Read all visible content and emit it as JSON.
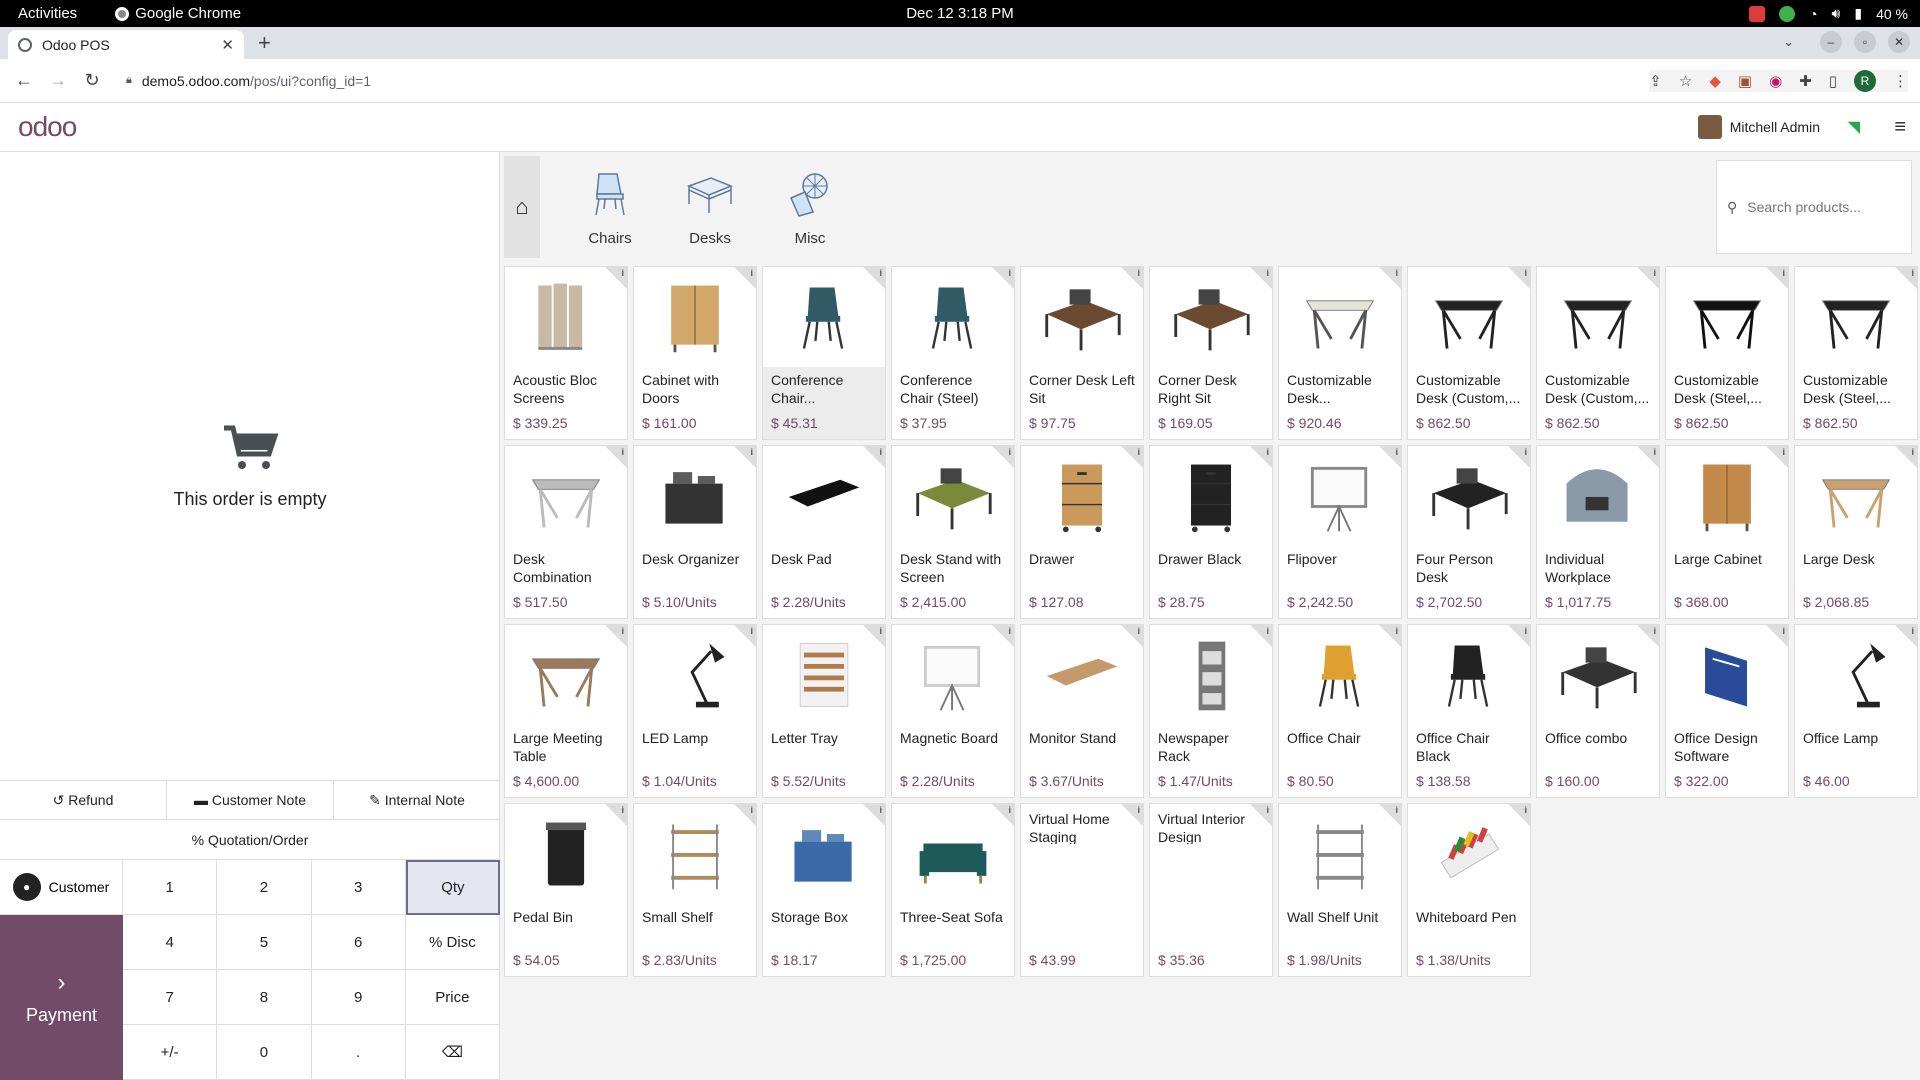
{
  "os": {
    "activities": "Activities",
    "app": "Google Chrome",
    "clock": "Dec 12  3:18 PM",
    "battery": "40 %"
  },
  "browser": {
    "tab_title": "Odoo POS",
    "url_host": "demo5.odoo.com",
    "url_path": "/pos/ui?config_id=1",
    "avatar": "R"
  },
  "header": {
    "logo": "odoo",
    "user": "Mitchell Admin"
  },
  "order": {
    "empty_text": "This order is empty"
  },
  "controls": {
    "refund": "Refund",
    "customer_note": "Customer Note",
    "internal_note": "Internal Note",
    "quotation": "Quotation/Order"
  },
  "pad": {
    "customer": "Customer",
    "payment": "Payment",
    "keys": [
      "1",
      "2",
      "3",
      "Qty",
      "4",
      "5",
      "6",
      "% Disc",
      "7",
      "8",
      "9",
      "Price",
      "+/-",
      "0",
      ".",
      "⌫"
    ]
  },
  "categories": [
    {
      "label": "Chairs"
    },
    {
      "label": "Desks"
    },
    {
      "label": "Misc"
    }
  ],
  "search": {
    "placeholder": "Search products..."
  },
  "products": [
    {
      "name": "Acoustic Bloc Screens",
      "price": "$ 339.25",
      "icon": "screen-icon",
      "color": "#c9b8a3"
    },
    {
      "name": "Cabinet with Doors",
      "price": "$ 161.00",
      "icon": "cabinet-icon",
      "color": "#d2a86a"
    },
    {
      "name": "Conference Chair...",
      "price": "$ 45.31",
      "icon": "chair-icon",
      "color": "#2f5a66"
    },
    {
      "name": "Conference Chair (Steel)",
      "price": "$ 37.95",
      "icon": "chair-icon",
      "color": "#2f5a66"
    },
    {
      "name": "Corner Desk Left Sit",
      "price": "$ 97.75",
      "icon": "desk-icon",
      "color": "#6b4a32"
    },
    {
      "name": "Corner Desk Right Sit",
      "price": "$ 169.05",
      "icon": "desk-icon",
      "color": "#6b4a32"
    },
    {
      "name": "Customizable Desk...",
      "price": "$ 920.46",
      "icon": "table-icon",
      "color": "#555555"
    },
    {
      "name": "Customizable Desk (Custom,...",
      "price": "$ 862.50",
      "icon": "table-icon",
      "color": "#222222"
    },
    {
      "name": "Customizable Desk (Custom,...",
      "price": "$ 862.50",
      "icon": "table-icon",
      "color": "#222222"
    },
    {
      "name": "Customizable Desk (Steel,...",
      "price": "$ 862.50",
      "icon": "table-icon",
      "color": "#111111"
    },
    {
      "name": "Customizable Desk (Steel,...",
      "price": "$ 862.50",
      "icon": "table-icon",
      "color": "#222222"
    },
    {
      "name": "Desk Combination",
      "price": "$ 517.50",
      "icon": "table-icon",
      "color": "#bbbbbb"
    },
    {
      "name": "Desk Organizer",
      "price": "$ 5.10/Units",
      "icon": "box-icon",
      "color": "#333333"
    },
    {
      "name": "Desk Pad",
      "price": "$ 2.28/Units",
      "icon": "pad-icon",
      "color": "#111111"
    },
    {
      "name": "Desk Stand with Screen",
      "price": "$ 2,415.00",
      "icon": "desk-icon",
      "color": "#7a8a3a"
    },
    {
      "name": "Drawer",
      "price": "$ 127.08",
      "icon": "drawer-icon",
      "color": "#c99a5c"
    },
    {
      "name": "Drawer Black",
      "price": "$ 28.75",
      "icon": "drawer-icon",
      "color": "#222222"
    },
    {
      "name": "Flipover",
      "price": "$ 2,242.50",
      "icon": "board-icon",
      "color": "#888888"
    },
    {
      "name": "Four Person Desk",
      "price": "$ 2,702.50",
      "icon": "desk-icon",
      "color": "#222222"
    },
    {
      "name": "Individual Workplace",
      "price": "$ 1,017.75",
      "icon": "booth-icon",
      "color": "#8a9aa8"
    },
    {
      "name": "Large Cabinet",
      "price": "$ 368.00",
      "icon": "cabinet-icon",
      "color": "#c48a4a"
    },
    {
      "name": "Large Desk",
      "price": "$ 2,068.85",
      "icon": "table-icon",
      "color": "#c9a170"
    },
    {
      "name": "Large Meeting Table",
      "price": "$ 4,600.00",
      "icon": "table-icon",
      "color": "#9a7a5a"
    },
    {
      "name": "LED Lamp",
      "price": "$ 1.04/Units",
      "icon": "lamp-icon",
      "color": "#222222"
    },
    {
      "name": "Letter Tray",
      "price": "$ 5.52/Units",
      "icon": "tray-icon",
      "color": "#b07a4a"
    },
    {
      "name": "Magnetic Board",
      "price": "$ 2.28/Units",
      "icon": "board-icon",
      "color": "#cccccc"
    },
    {
      "name": "Monitor Stand",
      "price": "$ 3.67/Units",
      "icon": "pad-icon",
      "color": "#c49a6a"
    },
    {
      "name": "Newspaper Rack",
      "price": "$ 1.47/Units",
      "icon": "rack-icon",
      "color": "#777777"
    },
    {
      "name": "Office Chair",
      "price": "$ 80.50",
      "icon": "chair-icon",
      "color": "#e0a030"
    },
    {
      "name": "Office Chair Black",
      "price": "$ 138.58",
      "icon": "chair-icon",
      "color": "#222222"
    },
    {
      "name": "Office combo",
      "price": "$ 160.00",
      "icon": "desk-icon",
      "color": "#333333"
    },
    {
      "name": "Office Design Software",
      "price": "$ 322.00",
      "icon": "software-icon",
      "color": "#2a4a9a"
    },
    {
      "name": "Office Lamp",
      "price": "$ 46.00",
      "icon": "lamp-icon",
      "color": "#222222"
    },
    {
      "name": "Pedal Bin",
      "price": "$ 54.05",
      "icon": "bin-icon",
      "color": "#222222"
    },
    {
      "name": "Small Shelf",
      "price": "$ 2.83/Units",
      "icon": "shelf-icon",
      "color": "#b08a5a"
    },
    {
      "name": "Storage Box",
      "price": "$ 18.17",
      "icon": "box-icon",
      "color": "#3a6aa8"
    },
    {
      "name": "Three-Seat Sofa",
      "price": "$ 1,725.00",
      "icon": "sofa-icon",
      "color": "#1e5a5a"
    },
    {
      "name": "Virtual Home Staging",
      "price": "$ 43.99",
      "icon": "",
      "color": ""
    },
    {
      "name": "Virtual Interior Design",
      "price": "$ 35.36",
      "icon": "",
      "color": ""
    },
    {
      "name": "Wall Shelf Unit",
      "price": "$ 1.98/Units",
      "icon": "shelf-icon",
      "color": "#888888"
    },
    {
      "name": "Whiteboard Pen",
      "price": "$ 1.38/Units",
      "icon": "pen-icon",
      "color": "#d04040"
    }
  ]
}
